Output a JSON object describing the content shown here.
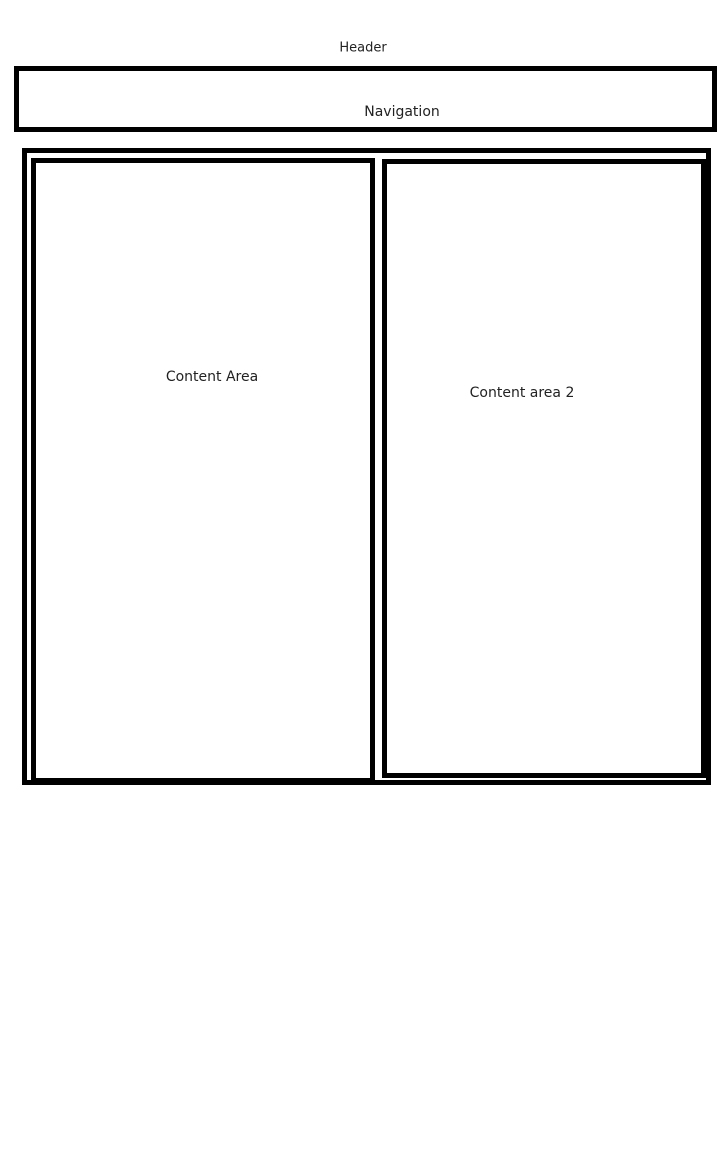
{
  "header": {
    "label": "Header"
  },
  "navigation": {
    "label": "Navigation"
  },
  "content_areas": [
    {
      "label": "Content Area"
    },
    {
      "label": "Content area 2"
    }
  ],
  "colors": {
    "border": "#000000",
    "background": "#ffffff",
    "text": "#222222"
  }
}
